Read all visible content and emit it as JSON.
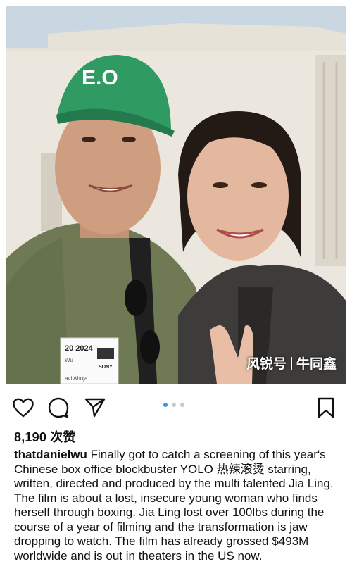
{
  "post": {
    "photo": {
      "cap_text": "E.O",
      "badge_date": "20 2024",
      "badge_line2": "Wu",
      "badge_line3": "avi Ahuja",
      "badge_logo": "SONY"
    },
    "carousel": {
      "count": 3,
      "active_index": 0,
      "accent_color": "#3897f0"
    },
    "likes": "8,190 次赞",
    "username": "thatdanielwu",
    "caption": " Finally got to catch a screening of this year's Chinese box office blockbuster YOLO 热辣滚烫 starring, written, directed and produced by the multi talented Jia Ling. The film is about a lost, insecure young woman who finds herself through boxing. Jia Ling lost over 100lbs during the course of a year of filming and the transformation is jaw dropping to watch. The film has already grossed $493M worldwide and is out in theaters in the US now."
  },
  "icons": {
    "like": "heart-icon",
    "comment": "comment-icon",
    "share": "send-icon",
    "save": "bookmark-icon"
  },
  "watermark": {
    "left": "风锐号",
    "right": "牛同鑫"
  }
}
